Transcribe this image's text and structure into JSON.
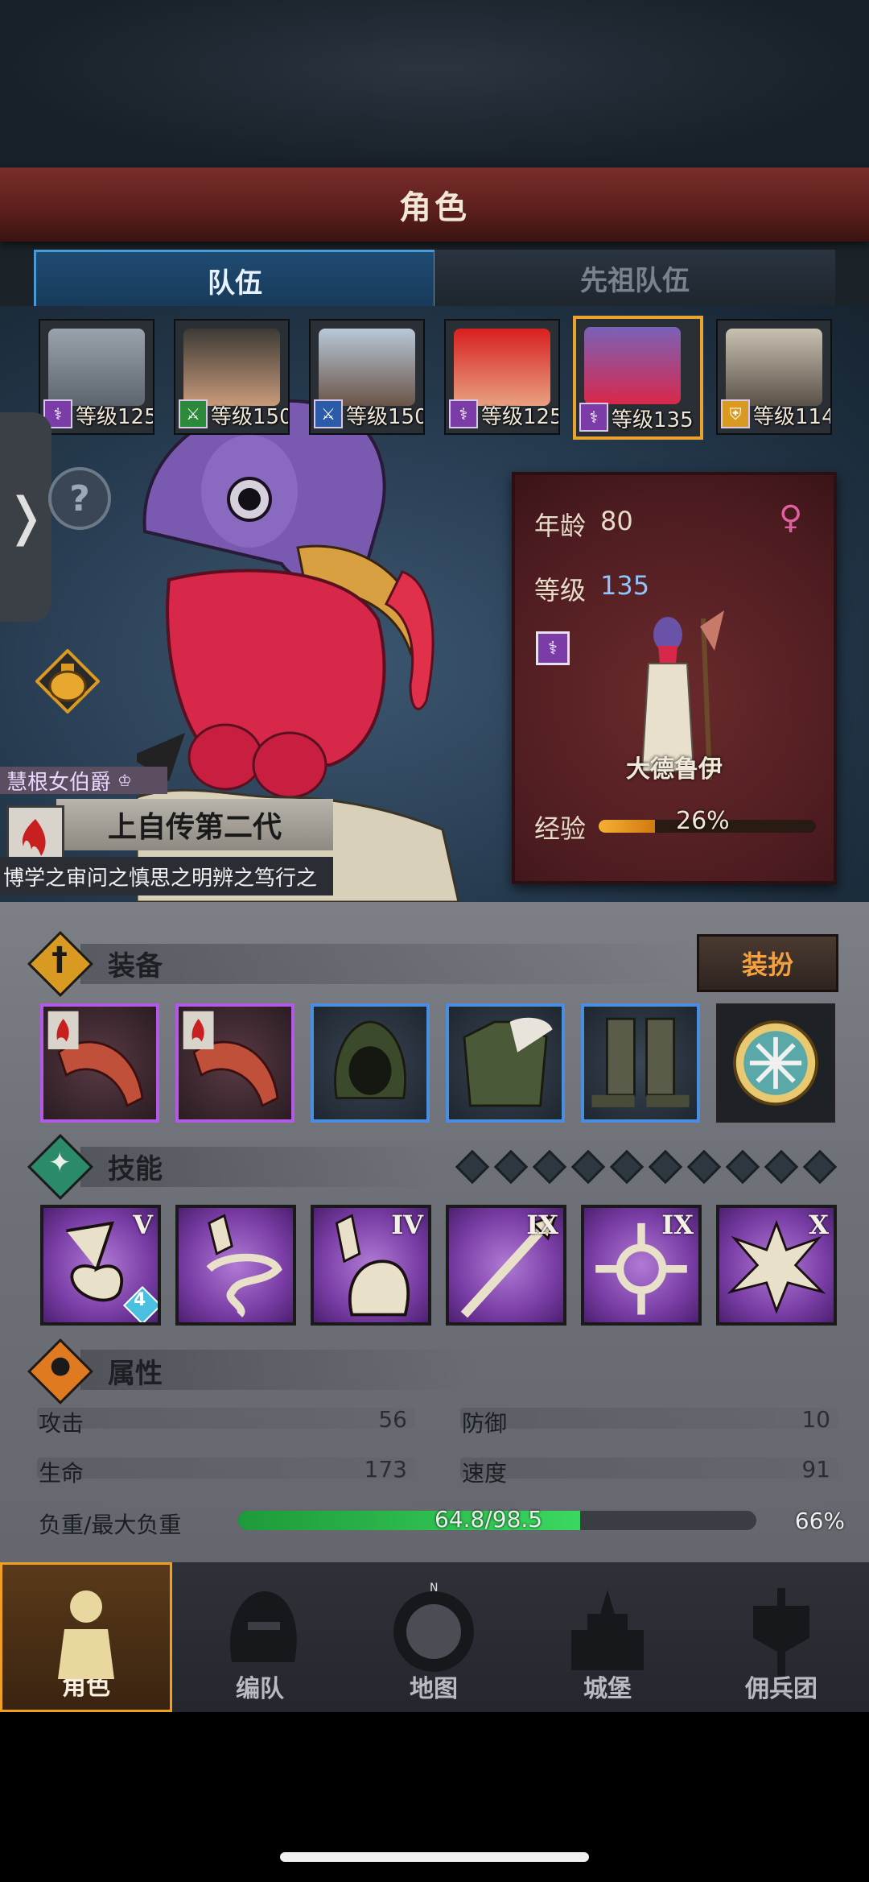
{
  "header": {
    "title": "角色"
  },
  "tabs": [
    {
      "label": "队伍",
      "active": true
    },
    {
      "label": "先祖队伍",
      "active": false
    }
  ],
  "roster": [
    {
      "level_text": "等级125",
      "class_icon": "staff-icon",
      "portrait": "bucket-helm-knight"
    },
    {
      "level_text": "等级150",
      "class_icon": "sword-icon",
      "portrait": "blindfolded-hat-woman"
    },
    {
      "level_text": "等级150",
      "class_icon": "sword-icon",
      "portrait": "crowned-elf"
    },
    {
      "level_text": "等级125",
      "class_icon": "staff-icon",
      "portrait": "gift-box-woman"
    },
    {
      "level_text": "等级135",
      "class_icon": "staff-icon",
      "portrait": "turkey",
      "selected": true
    },
    {
      "level_text": "等级114",
      "class_icon": "shield-icon",
      "portrait": "horned-helm-warrior"
    }
  ],
  "character": {
    "age_label": "年龄",
    "age_value": "80",
    "level_label": "等级",
    "level_value": "135",
    "gender_icon": "female-icon",
    "class_name": "大德鲁伊",
    "exp_label": "经验",
    "exp_percent_text": "26%",
    "exp_fraction": 0.26,
    "title_tag": "慧根女伯爵",
    "name": "上自传第二代",
    "motto": "博学之审问之慎思之明辨之笃行之"
  },
  "equipment": {
    "section_title": "装备",
    "costume_button": "装扮",
    "slots": [
      {
        "name": "red-feather-weapon",
        "rarity": "purple"
      },
      {
        "name": "red-feather-weapon-2",
        "rarity": "purple"
      },
      {
        "name": "green-hood",
        "rarity": "blue"
      },
      {
        "name": "fur-collar-armor",
        "rarity": "blue"
      },
      {
        "name": "wrapped-boots",
        "rarity": "blue"
      },
      {
        "name": "snowflake-medallion",
        "rarity": "plain"
      }
    ]
  },
  "skills": {
    "section_title": "技能",
    "gem_count": 10,
    "items": [
      {
        "name": "music-note-skill",
        "rank": "V",
        "badge": "4"
      },
      {
        "name": "crystal-tornado-skill",
        "rank": ""
      },
      {
        "name": "crystal-hand-skill",
        "rank": "IV"
      },
      {
        "name": "spear-skill",
        "rank": "IX"
      },
      {
        "name": "crosshair-skill",
        "rank": "IX"
      },
      {
        "name": "burst-skill",
        "rank": "X"
      }
    ]
  },
  "attributes": {
    "section_title": "属性",
    "attack_label": "攻击",
    "attack_value": "56",
    "defense_label": "防御",
    "defense_value": "10",
    "hp_label": "生命",
    "hp_value": "173",
    "speed_label": "速度",
    "speed_value": "91",
    "weight_label": "负重/最大负重",
    "weight_text": "64.8/98.5",
    "weight_percent": "66%",
    "weight_fraction": 0.66
  },
  "nav": [
    {
      "label": "角色",
      "active": true
    },
    {
      "label": "编队"
    },
    {
      "label": "地图"
    },
    {
      "label": "城堡"
    },
    {
      "label": "佣兵团"
    }
  ],
  "colors": {
    "accent": "#f0a020",
    "exp": "#f5b034",
    "weight": "#3ad860",
    "rare_purple": "#b25ae6",
    "rare_blue": "#4a8ee0"
  }
}
